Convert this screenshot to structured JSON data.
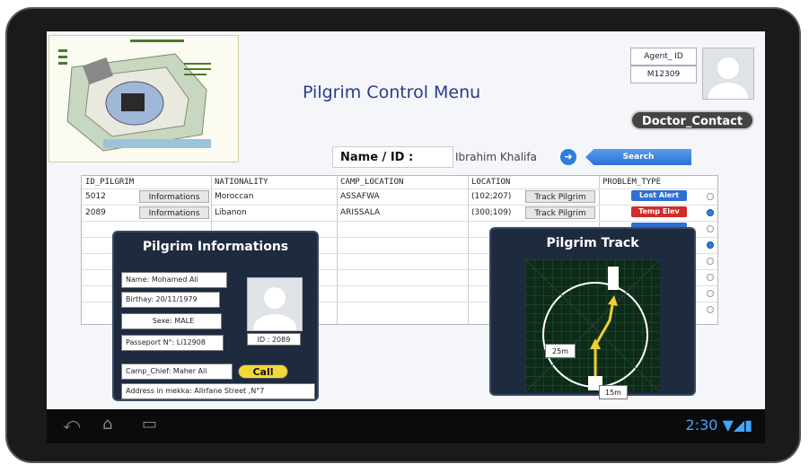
{
  "app": {
    "title": "Pilgrim Control  Menu",
    "agent_label": "Agent_ ID",
    "agent_id": "M12309",
    "doctor_contact": "Doctor_Contact"
  },
  "search": {
    "name_label": "Name / ID :",
    "name_value": "Ibrahim Khalifa",
    "search_button": "Search"
  },
  "table": {
    "headers": [
      "ID_PILGRIM",
      "NATIONALITY",
      "CAMP_LOCATION",
      "LOCATION",
      "PROBLEM_TYPE"
    ],
    "rows": [
      {
        "id": "5012",
        "info": "Informations",
        "nationality": "Moroccan",
        "camp": "ASSAFWA",
        "location": "(102;207)",
        "track": "Track Pilgrim"
      },
      {
        "id": "2089",
        "info": "Informations",
        "nationality": "Libanon",
        "camp": "ARISSALA",
        "location": "(300;109)",
        "track": "Track Pilgrim"
      }
    ],
    "problems": [
      {
        "label": "Lost Alert",
        "color": "#2f6fd6"
      },
      {
        "label": "Temp Elev",
        "color": "#d42a2a"
      },
      {
        "label": "",
        "color": "#2f6fd6"
      }
    ]
  },
  "pilgrim_info": {
    "title": "Pilgrim Informations",
    "name": "Name: Mohamed Ali",
    "birthday": "Birthay: 20/11/1979",
    "sex": "Sexe: MALE",
    "passport": "Passeport N°: Li12908",
    "id": "ID : 2089",
    "camp_chief": "Camp_Chief: Maher Ali",
    "call": "Call",
    "address": "Address in mekka: AlIrfane Street ,N°7"
  },
  "pilgrim_track": {
    "title": "Pilgrim Track",
    "distance_1": "25m",
    "distance_2": "15m"
  },
  "status_bar": {
    "time": "2:30"
  },
  "colors": {
    "accent": "#2b7de0",
    "panel": "#1e2a3e",
    "alert_red": "#d42a2a"
  }
}
